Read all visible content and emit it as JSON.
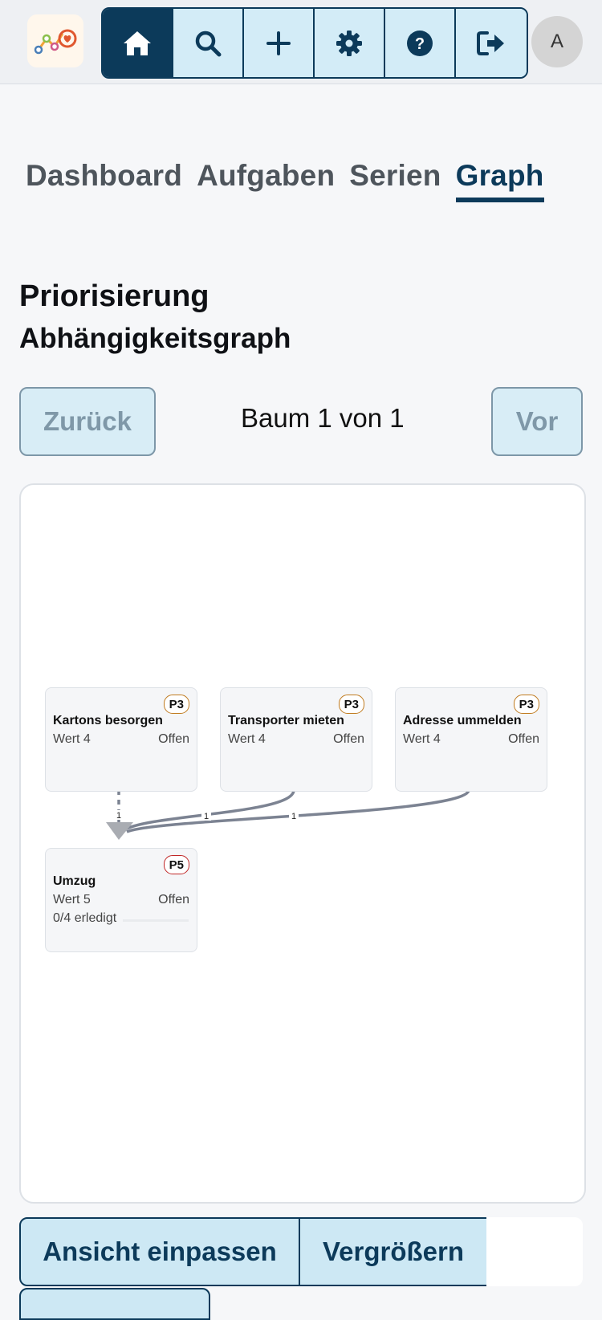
{
  "topbar": {
    "nav": [
      {
        "name": "home-icon",
        "active": true
      },
      {
        "name": "search-icon",
        "active": false
      },
      {
        "name": "plus-icon",
        "active": false
      },
      {
        "name": "gear-icon",
        "active": false
      },
      {
        "name": "help-icon",
        "active": false
      },
      {
        "name": "logout-icon",
        "active": false
      }
    ],
    "avatar_initial": "A"
  },
  "tabs": [
    "Dashboard",
    "Aufgaben",
    "Serien",
    "Graph"
  ],
  "active_tab": "Graph",
  "headings": {
    "title": "Priorisierung",
    "subtitle": "Abhängigkeitsgraph"
  },
  "pager": {
    "prev": "Zurück",
    "label": "Baum 1 von 1",
    "next": "Vor"
  },
  "graph": {
    "nodes": [
      {
        "id": "kartons",
        "title": "Kartons besorgen",
        "priority": "P3",
        "value": "Wert 4",
        "status": "Offen"
      },
      {
        "id": "transporter",
        "title": "Transporter mieten",
        "priority": "P3",
        "value": "Wert 4",
        "status": "Offen"
      },
      {
        "id": "adresse",
        "title": "Adresse ummelden",
        "priority": "P3",
        "value": "Wert 4",
        "status": "Offen"
      },
      {
        "id": "umzug",
        "title": "Umzug",
        "priority": "P5",
        "value": "Wert 5",
        "status": "Offen",
        "progress_text": "0/4 erledigt",
        "progress": 0
      }
    ],
    "edges": [
      {
        "from": "kartons",
        "to": "umzug",
        "label": "1"
      },
      {
        "from": "transporter",
        "to": "umzug",
        "label": "1"
      },
      {
        "from": "adresse",
        "to": "umzug",
        "label": "1"
      }
    ]
  },
  "actions": {
    "fit": "Ansicht einpassen",
    "zoom_in": "Vergrößern"
  },
  "colors": {
    "primary": "#0c3a5a",
    "button_bg": "#cde8f4",
    "p3_border": "#c07b1f",
    "p5_border": "#c02626",
    "edge": "#7c8392"
  }
}
